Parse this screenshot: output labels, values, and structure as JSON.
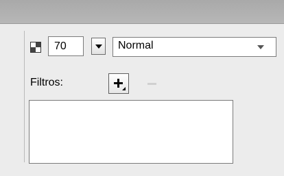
{
  "opacity": {
    "value": "70",
    "icon": "alpha-checker-icon"
  },
  "blend_mode": {
    "selected": "Normal",
    "icon": "dropdown-arrow-icon"
  },
  "filters": {
    "label": "Filtros:",
    "add_icon": "plus-icon",
    "remove_icon": "minus-icon",
    "items": []
  }
}
